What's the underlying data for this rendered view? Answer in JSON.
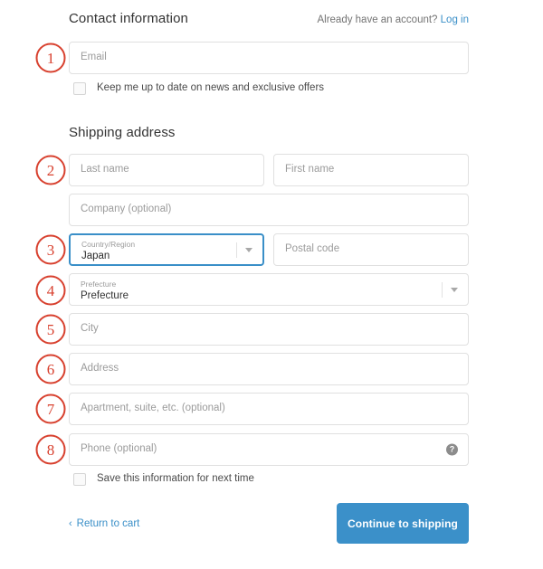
{
  "contact": {
    "title": "Contact information",
    "account_note": "Already have an account?",
    "login_label": "Log in",
    "email_placeholder": "Email",
    "newsletter_label": "Keep me up to date on news and exclusive offers"
  },
  "shipping": {
    "title": "Shipping address",
    "last_name_placeholder": "Last name",
    "first_name_placeholder": "First name",
    "company_placeholder": "Company (optional)",
    "country_label": "Country/Region",
    "country_value": "Japan",
    "postal_placeholder": "Postal code",
    "prefecture_label": "Prefecture",
    "prefecture_value": "Prefecture",
    "city_placeholder": "City",
    "address_placeholder": "Address",
    "apartment_placeholder": "Apartment, suite, etc. (optional)",
    "phone_placeholder": "Phone (optional)",
    "phone_help_glyph": "?",
    "save_label": "Save this information for next time"
  },
  "footer": {
    "return_chevron": "‹",
    "return_label": "Return to cart",
    "continue_label": "Continue to shipping"
  },
  "annotations": [
    {
      "number": "1"
    },
    {
      "number": "2"
    },
    {
      "number": "3"
    },
    {
      "number": "4"
    },
    {
      "number": "5"
    },
    {
      "number": "6"
    },
    {
      "number": "7"
    },
    {
      "number": "8"
    }
  ],
  "colors": {
    "accent_blue": "#3b90c9",
    "link_blue": "#3a8fc8",
    "annotation_red": "#d8412f",
    "border_gray": "#e0e0e0",
    "placeholder_gray": "#9b9b9b"
  }
}
